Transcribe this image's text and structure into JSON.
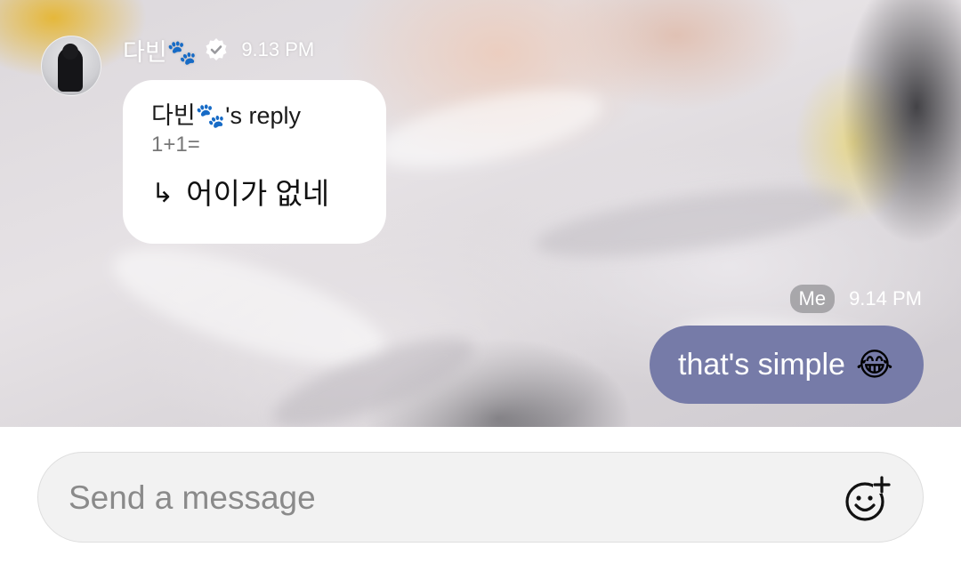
{
  "incoming": {
    "sender_name": "다빈🐾",
    "time": "9.13 PM",
    "reply": {
      "title": "다빈🐾's reply",
      "quoted_text": "1+1=",
      "arrow": "↳",
      "message": "어이가 없네"
    }
  },
  "outgoing": {
    "badge": "Me",
    "time": "9.14 PM",
    "text": "that's simple",
    "emoji": "😂"
  },
  "composer": {
    "placeholder": "Send a message"
  },
  "colors": {
    "outgoing_bubble": "#767ba8",
    "incoming_bubble": "#ffffff",
    "composer_bg": "#f2f2f2"
  },
  "icons": {
    "verified": "verified-badge-icon",
    "add_emoji": "add-emoji-icon",
    "reply_arrow": "reply-arrow-icon"
  }
}
